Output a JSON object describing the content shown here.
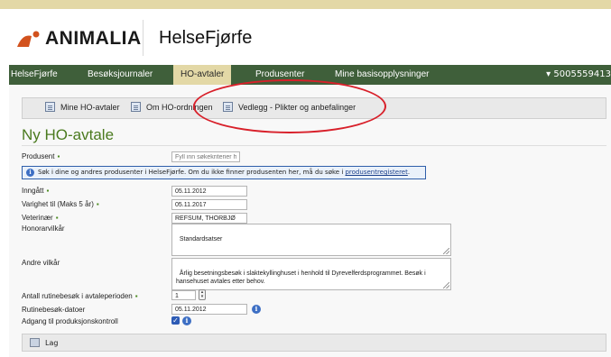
{
  "header": {
    "logo_text": "ANIMALIA",
    "app_title": "HelseFjørfe"
  },
  "nav": {
    "items": [
      {
        "label": "HelseFjørfe"
      },
      {
        "label": "Besøksjournaler"
      },
      {
        "label": "HO-avtaler"
      },
      {
        "label": "Produsenter"
      },
      {
        "label": "Mine basisopplysninger"
      }
    ],
    "user": "▾ 5005559413"
  },
  "subnav": {
    "items": [
      {
        "label": "Mine HO-avtaler"
      },
      {
        "label": "Om HO-ordningen"
      },
      {
        "label": "Vedlegg - Plikter og anbefalinger"
      }
    ]
  },
  "page": {
    "title": "Ny HO-avtale"
  },
  "form": {
    "produsent": {
      "label": "Produsent",
      "placeholder": "Fyll inn søkekriterier he"
    },
    "info_text": "Søk i dine og andres produsenter i HelseFjørfe. Om du ikke finner produsenten her, må du søke i ",
    "info_link": "produsentregisteret",
    "info_end": ".",
    "inngatt": {
      "label": "Inngått",
      "value": "05.11.2012"
    },
    "varighet": {
      "label": "Varighet til (Maks 5 år)",
      "value": "05.11.2017"
    },
    "veterinar": {
      "label": "Veterinær",
      "value": "REFSUM, THORBJØ"
    },
    "honorar": {
      "label": "Honorarvilkår",
      "value": "Standardsatser"
    },
    "andre": {
      "label": "Andre vilkår",
      "value": "Årlig besetningsbesøk i slaktekyllinghuset i henhold til Dyrevelferdsprogrammet. Besøk i hansehuset avtales etter behov."
    },
    "antall": {
      "label": "Antall rutinebesøk i avtaleperioden",
      "value": "1"
    },
    "rutinedatoer": {
      "label": "Rutinebesøk-datoer",
      "value": "05.11.2012"
    },
    "adgang": {
      "label": "Adgang til produksjonskontroll"
    }
  },
  "footer": {
    "save_label": "Lag"
  },
  "colors": {
    "nav_bg": "#3f5f3a",
    "accent_green": "#4a7a1e",
    "tab_active": "#e3d8a6",
    "annotation_red": "#d8202a"
  }
}
